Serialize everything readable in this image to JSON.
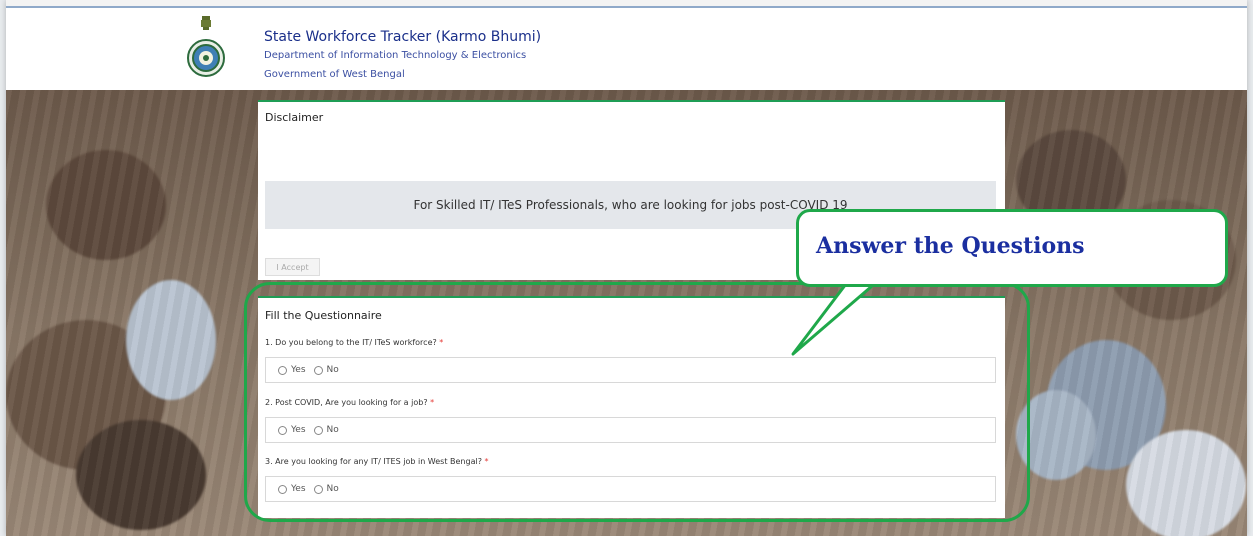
{
  "header": {
    "title": "State Workforce Tracker (Karmo Bhumi)",
    "department": "Department of Information Technology & Electronics",
    "government": "Government of West Bengal"
  },
  "disclaimer": {
    "title": "Disclaimer",
    "banner": "For Skilled IT/ ITeS Professionals, who are looking for jobs post-COVID 19",
    "accept_label": "I Accept"
  },
  "questionnaire": {
    "title": "Fill the Questionnaire",
    "questions": [
      {
        "label": "1. Do you belong to the IT/ ITeS workforce?",
        "required": "*",
        "options": [
          "Yes",
          "No"
        ]
      },
      {
        "label": "2. Post COVID, Are you looking for a job?",
        "required": "*",
        "options": [
          "Yes",
          "No"
        ]
      },
      {
        "label": "3. Are you looking for any IT/ ITES job in West Bengal?",
        "required": "*",
        "options": [
          "Yes",
          "No"
        ]
      }
    ]
  },
  "callout": {
    "text": "Answer the Questions"
  },
  "colors": {
    "accent_green": "#1fa84a",
    "brand_blue": "#1a2f8a",
    "callout_blue": "#1b2fa0",
    "required_red": "#e53935"
  },
  "icons": {
    "emblem": "west-bengal-emblem-icon",
    "radio": "radio-button-icon"
  }
}
